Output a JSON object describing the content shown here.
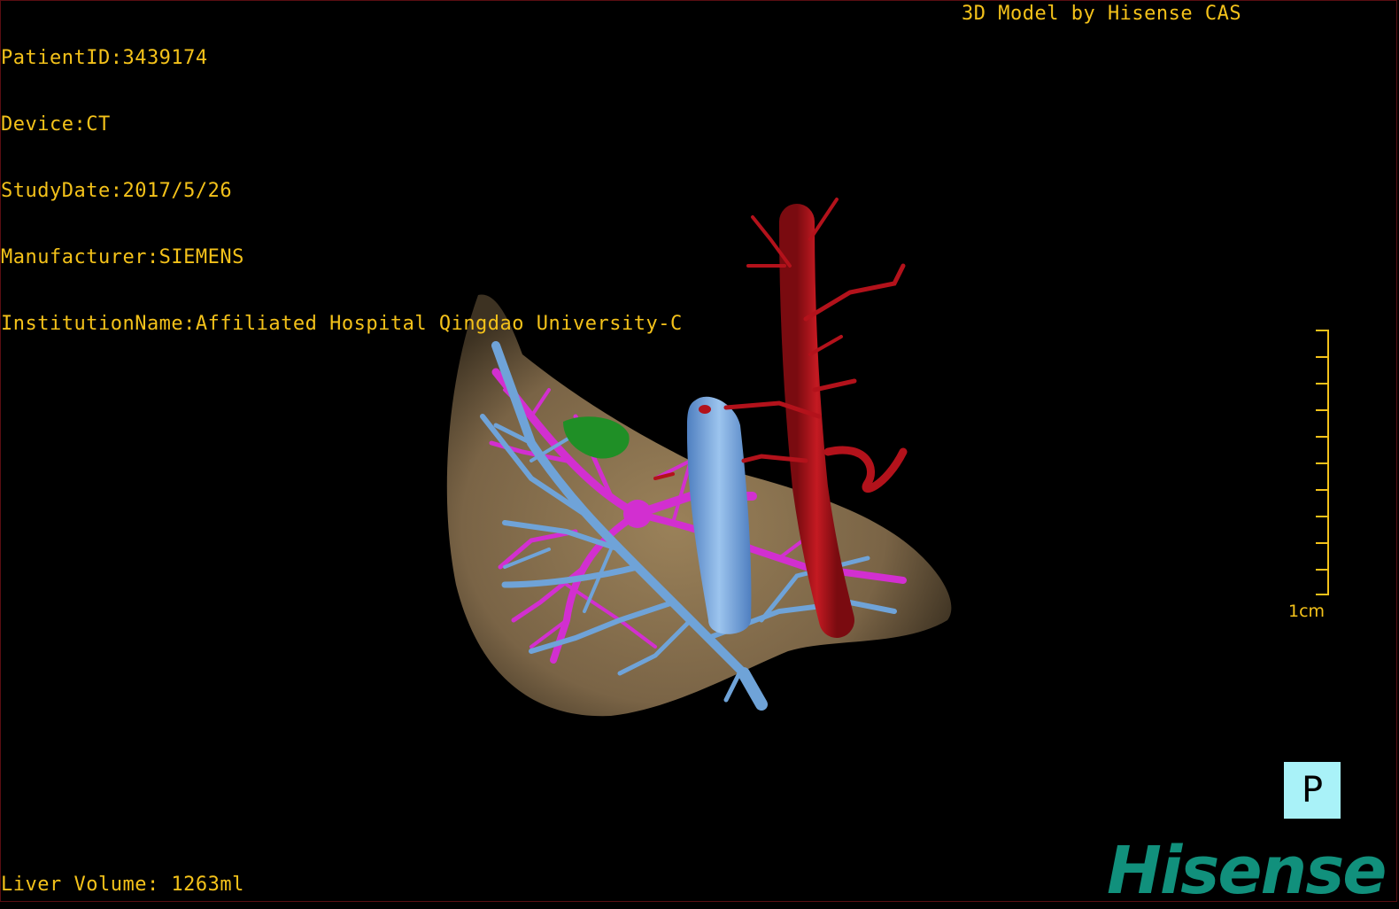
{
  "header": {
    "info_lines": [
      "PatientID:3439174",
      "Device:CT",
      "StudyDate:2017/5/26",
      "Manufacturer:SIEMENS",
      "InstitutionName:Affiliated Hospital Qingdao University-C"
    ],
    "credit": "3D Model by Hisense CAS"
  },
  "scale_bar": {
    "label": "1cm"
  },
  "orientation_button": {
    "label": "P"
  },
  "footer": {
    "liver_volume": "Liver Volume: 1263ml"
  },
  "brand": {
    "logo_text": "Hisense"
  },
  "colors": {
    "hud_text": "#f4c21a",
    "liver": "#8a7250",
    "portal_vein": "#6fa3d8",
    "hepatic_vein": "#d22fd0",
    "artery": "#b3121b",
    "lesion": "#1f8f26",
    "logo": "#11907c"
  }
}
